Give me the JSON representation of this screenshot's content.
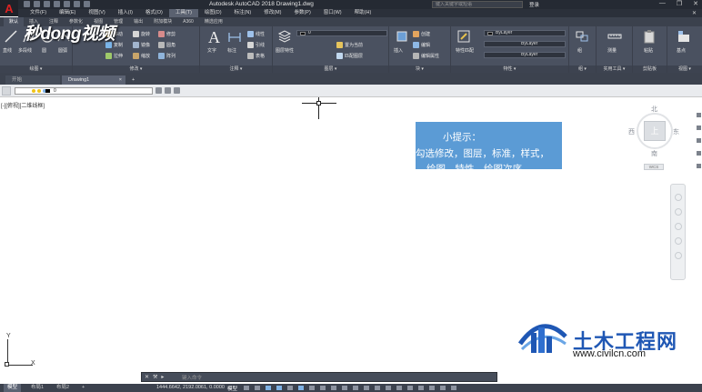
{
  "titlebar": {
    "app_title": "Autodesk AutoCAD 2018   Drawing1.dwg",
    "search_placeholder": "键入关键字或短语",
    "login": "登录",
    "min": "—",
    "max": "❐",
    "close": "✕"
  },
  "app_logo": "A",
  "watermark_top": "秒dong视频",
  "menubar": {
    "items": [
      "文件(F)",
      "编辑(E)",
      "视图(V)",
      "插入(I)",
      "格式(O)",
      "工具(T)",
      "绘图(D)",
      "标注(N)",
      "修改(M)",
      "参数(P)",
      "窗口(W)",
      "帮助(H)"
    ],
    "close_icon": "✕"
  },
  "ribbon_tabs": [
    "默认",
    "插入",
    "注释",
    "参数化",
    "视图",
    "管理",
    "输出",
    "附加模块",
    "A360",
    "精选应用"
  ],
  "ribbon": {
    "draw": {
      "title": "绘图 ▾",
      "line": "直线",
      "polyline": "多段线",
      "circle": "圆",
      "arc": "圆弧"
    },
    "modify": {
      "title": "修改 ▾",
      "move": "移动",
      "rotate": "旋转",
      "trim": "修剪",
      "copy": "复制",
      "mirror": "镜像",
      "fillet": "圆角",
      "stretch": "拉伸",
      "scale": "缩放",
      "array": "阵列"
    },
    "annotation": {
      "title": "注释 ▾",
      "text": "文字",
      "dimension": "标注",
      "linear": "线性",
      "leader": "引线",
      "table": "表格"
    },
    "layers": {
      "title": "图层 ▾",
      "props": "图层特性",
      "current_layer": "0",
      "make_current": "置为当前",
      "match": "匹配图层"
    },
    "block": {
      "title": "块 ▾",
      "insert": "插入",
      "create": "创建",
      "edit": "编辑",
      "edit_attr": "编辑属性"
    },
    "properties": {
      "title": "特性 ▾",
      "match": "特性匹配",
      "color": "ByLayer",
      "linetype": "ByLayer",
      "lineweight": "ByLayer"
    },
    "groups": {
      "title": "组 ▾",
      "group": "组"
    },
    "utilities": {
      "title": "实用工具 ▾",
      "measure": "测量"
    },
    "clipboard": {
      "title": "剪贴板",
      "paste": "粘贴"
    },
    "view": {
      "title": "视图 ▾",
      "base": "基点"
    }
  },
  "doc_tabs": {
    "start": "开始",
    "drawing": "Drawing1",
    "close": "×",
    "plus": "+"
  },
  "layerbar": {
    "layer": "0"
  },
  "canvas": {
    "viewport_label": "[-][俯视][二维线框]",
    "tip": {
      "line1": "小提示：",
      "line2": "勾选修改，图层，标准，样式，",
      "line3": "绘图，特性，绘图次序"
    }
  },
  "viewcube": {
    "north": "北",
    "south": "南",
    "west": "西",
    "east": "东",
    "face": "上",
    "wcs": "WCS"
  },
  "ucs": {
    "x": "X",
    "y": "Y"
  },
  "logo": {
    "cn": "土木工程网",
    "url": "www.civilcn.com"
  },
  "cmdline": {
    "placeholder": "键入命令",
    "close": "✕"
  },
  "layout_tabs": {
    "model": "模型",
    "layout1": "布局1",
    "layout2": "布局2",
    "plus": "+"
  },
  "statusbar": {
    "coords": "1444.6642, 2192.0061, 0.0000",
    "model": "模型"
  },
  "colors": {
    "tip_bg": "#5b9bd5",
    "ribbon": "#4a5160",
    "title": "#252a33",
    "logo_blue": "#1f57b4"
  }
}
